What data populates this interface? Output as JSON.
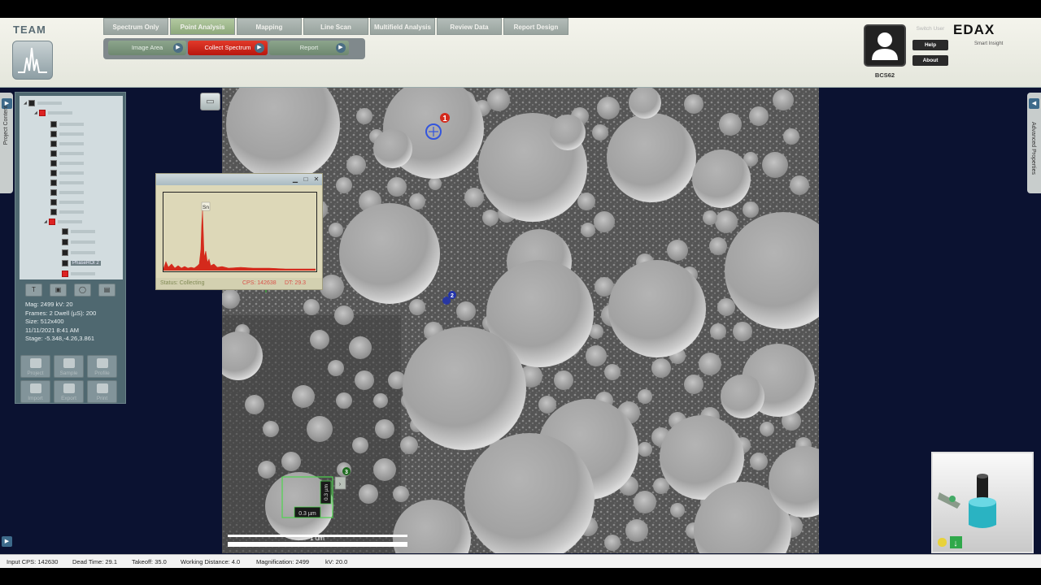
{
  "brand": {
    "name": "TEAM"
  },
  "tabs": [
    "Spectrum Only",
    "Point Analysis",
    "Mapping",
    "Line Scan",
    "Multifield Analysis",
    "Review Data",
    "Report Design"
  ],
  "active_tab": "Point Analysis",
  "subtabs": [
    "Image Area",
    "Collect Spectrum",
    "Report"
  ],
  "active_subtab": "Collect Spectrum",
  "user": {
    "name": "BCS62",
    "switch_label": "Switch User",
    "help_label": "Help",
    "about_label": "About"
  },
  "vendor": {
    "name": "EDAX",
    "tagline": "Smart Insight"
  },
  "sides": {
    "left_label": "Project Content",
    "right_label": "Advanced Properties"
  },
  "tree": {
    "selected_label": "PhaseROI 2"
  },
  "image_info": {
    "line1": "Mag: 2499  kV: 20",
    "line2": "Frames: 2  Dwell (µS): 200",
    "line3": "Size: 512x400",
    "line4": "11/11/2021 8:41 AM",
    "line5": "Stage: -5.348,-4.26,3.861"
  },
  "panel_buttons": [
    "Project",
    "Sample",
    "Profile",
    "Import",
    "Export",
    "Print"
  ],
  "spectrum": {
    "peak_label": "Sn",
    "status_label": "Status: Collecting",
    "cps_label": "CPS: 142638",
    "dt_label": "DT: 29.3"
  },
  "sem": {
    "points": [
      "1",
      "2",
      "3"
    ],
    "roi_width_label": "0.3 µm",
    "roi_height_label": "0.3 µm",
    "scalebar_label": "1 um"
  },
  "status_bar": {
    "input_cps": "Input CPS: 142630",
    "dead_time": "Dead Time: 29.1",
    "takeoff": "Takeoff: 35.0",
    "working_distance": "Working Distance: 4.0",
    "magnification": "Magnification: 2499",
    "kv": "kV: 20.0"
  },
  "colors": {
    "accent_red": "#d42a1c",
    "panel": "#4f6870",
    "header": "#ecede4",
    "background": "#0b1231",
    "roi_green": "#4fd44f"
  }
}
